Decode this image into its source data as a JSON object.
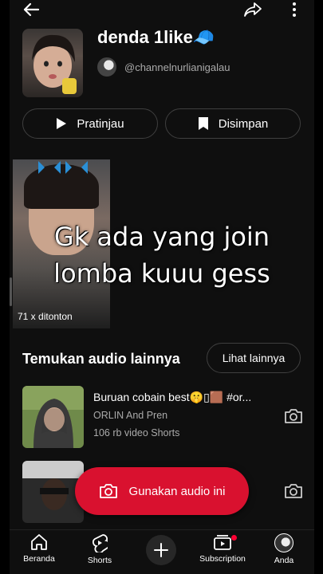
{
  "header": {
    "back_icon": "arrow-left-icon",
    "share_icon": "share-icon",
    "more_icon": "more-vertical-icon"
  },
  "audio": {
    "title": "denda 1like🧢",
    "channel": "@channelnurlianigalau"
  },
  "actions": {
    "preview_label": "Pratinjau",
    "saved_label": "Disimpan"
  },
  "featured_video": {
    "views": "71 x ditonton",
    "overlay_text_line1": "Gk ada yang join",
    "overlay_text_line2": "lomba kuuu gess"
  },
  "more_audio": {
    "section_title": "Temukan audio lainnya",
    "see_more_label": "Lihat lainnya",
    "items": [
      {
        "title": "Buruan cobain best🤫▯🟫 #or...",
        "artist": "ORLIN And Pren",
        "count": "106 rb video Shorts"
      },
      {
        "title": "",
        "artist": "",
        "count": ""
      }
    ]
  },
  "use_audio_button": {
    "label": "Gunakan audio ini"
  },
  "bottom_nav": {
    "items": [
      {
        "label": "Beranda",
        "icon": "home-icon"
      },
      {
        "label": "Shorts",
        "icon": "shorts-icon"
      },
      {
        "label": "",
        "icon": "create-icon"
      },
      {
        "label": "Subscription",
        "icon": "subscriptions-icon"
      },
      {
        "label": "Anda",
        "icon": "avatar-icon"
      }
    ]
  },
  "colors": {
    "background": "#0f0f0f",
    "accent": "#d9112f",
    "notification": "#ff0033"
  }
}
